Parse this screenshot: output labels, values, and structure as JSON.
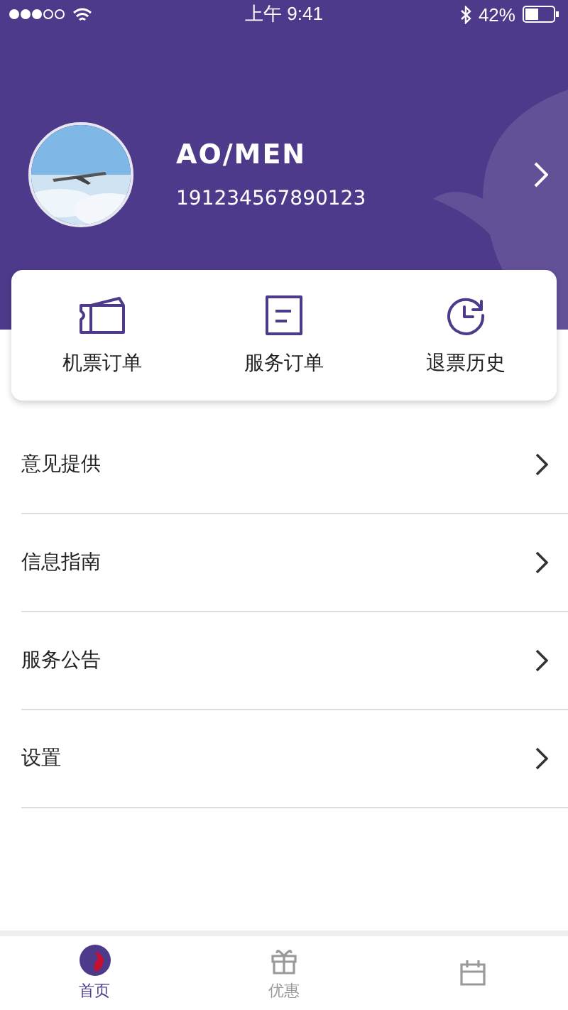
{
  "status_bar": {
    "time": "上午 9:41",
    "battery": "42%"
  },
  "profile": {
    "name": "AO/MEN",
    "number": "191234567890123"
  },
  "shortcuts": [
    {
      "kind": "ticket",
      "label": "机票订单"
    },
    {
      "kind": "document",
      "label": "服务订单"
    },
    {
      "kind": "history",
      "label": "退票历史"
    }
  ],
  "menu": [
    {
      "label": "意见提供"
    },
    {
      "label": "信息指南"
    },
    {
      "label": "服务公告"
    },
    {
      "label": "设置"
    }
  ],
  "tab_bar": [
    {
      "kind": "home",
      "label": "首页",
      "selected": true
    },
    {
      "kind": "gift",
      "label": "优惠",
      "selected": false
    },
    {
      "kind": "calendar",
      "selected": false
    }
  ]
}
